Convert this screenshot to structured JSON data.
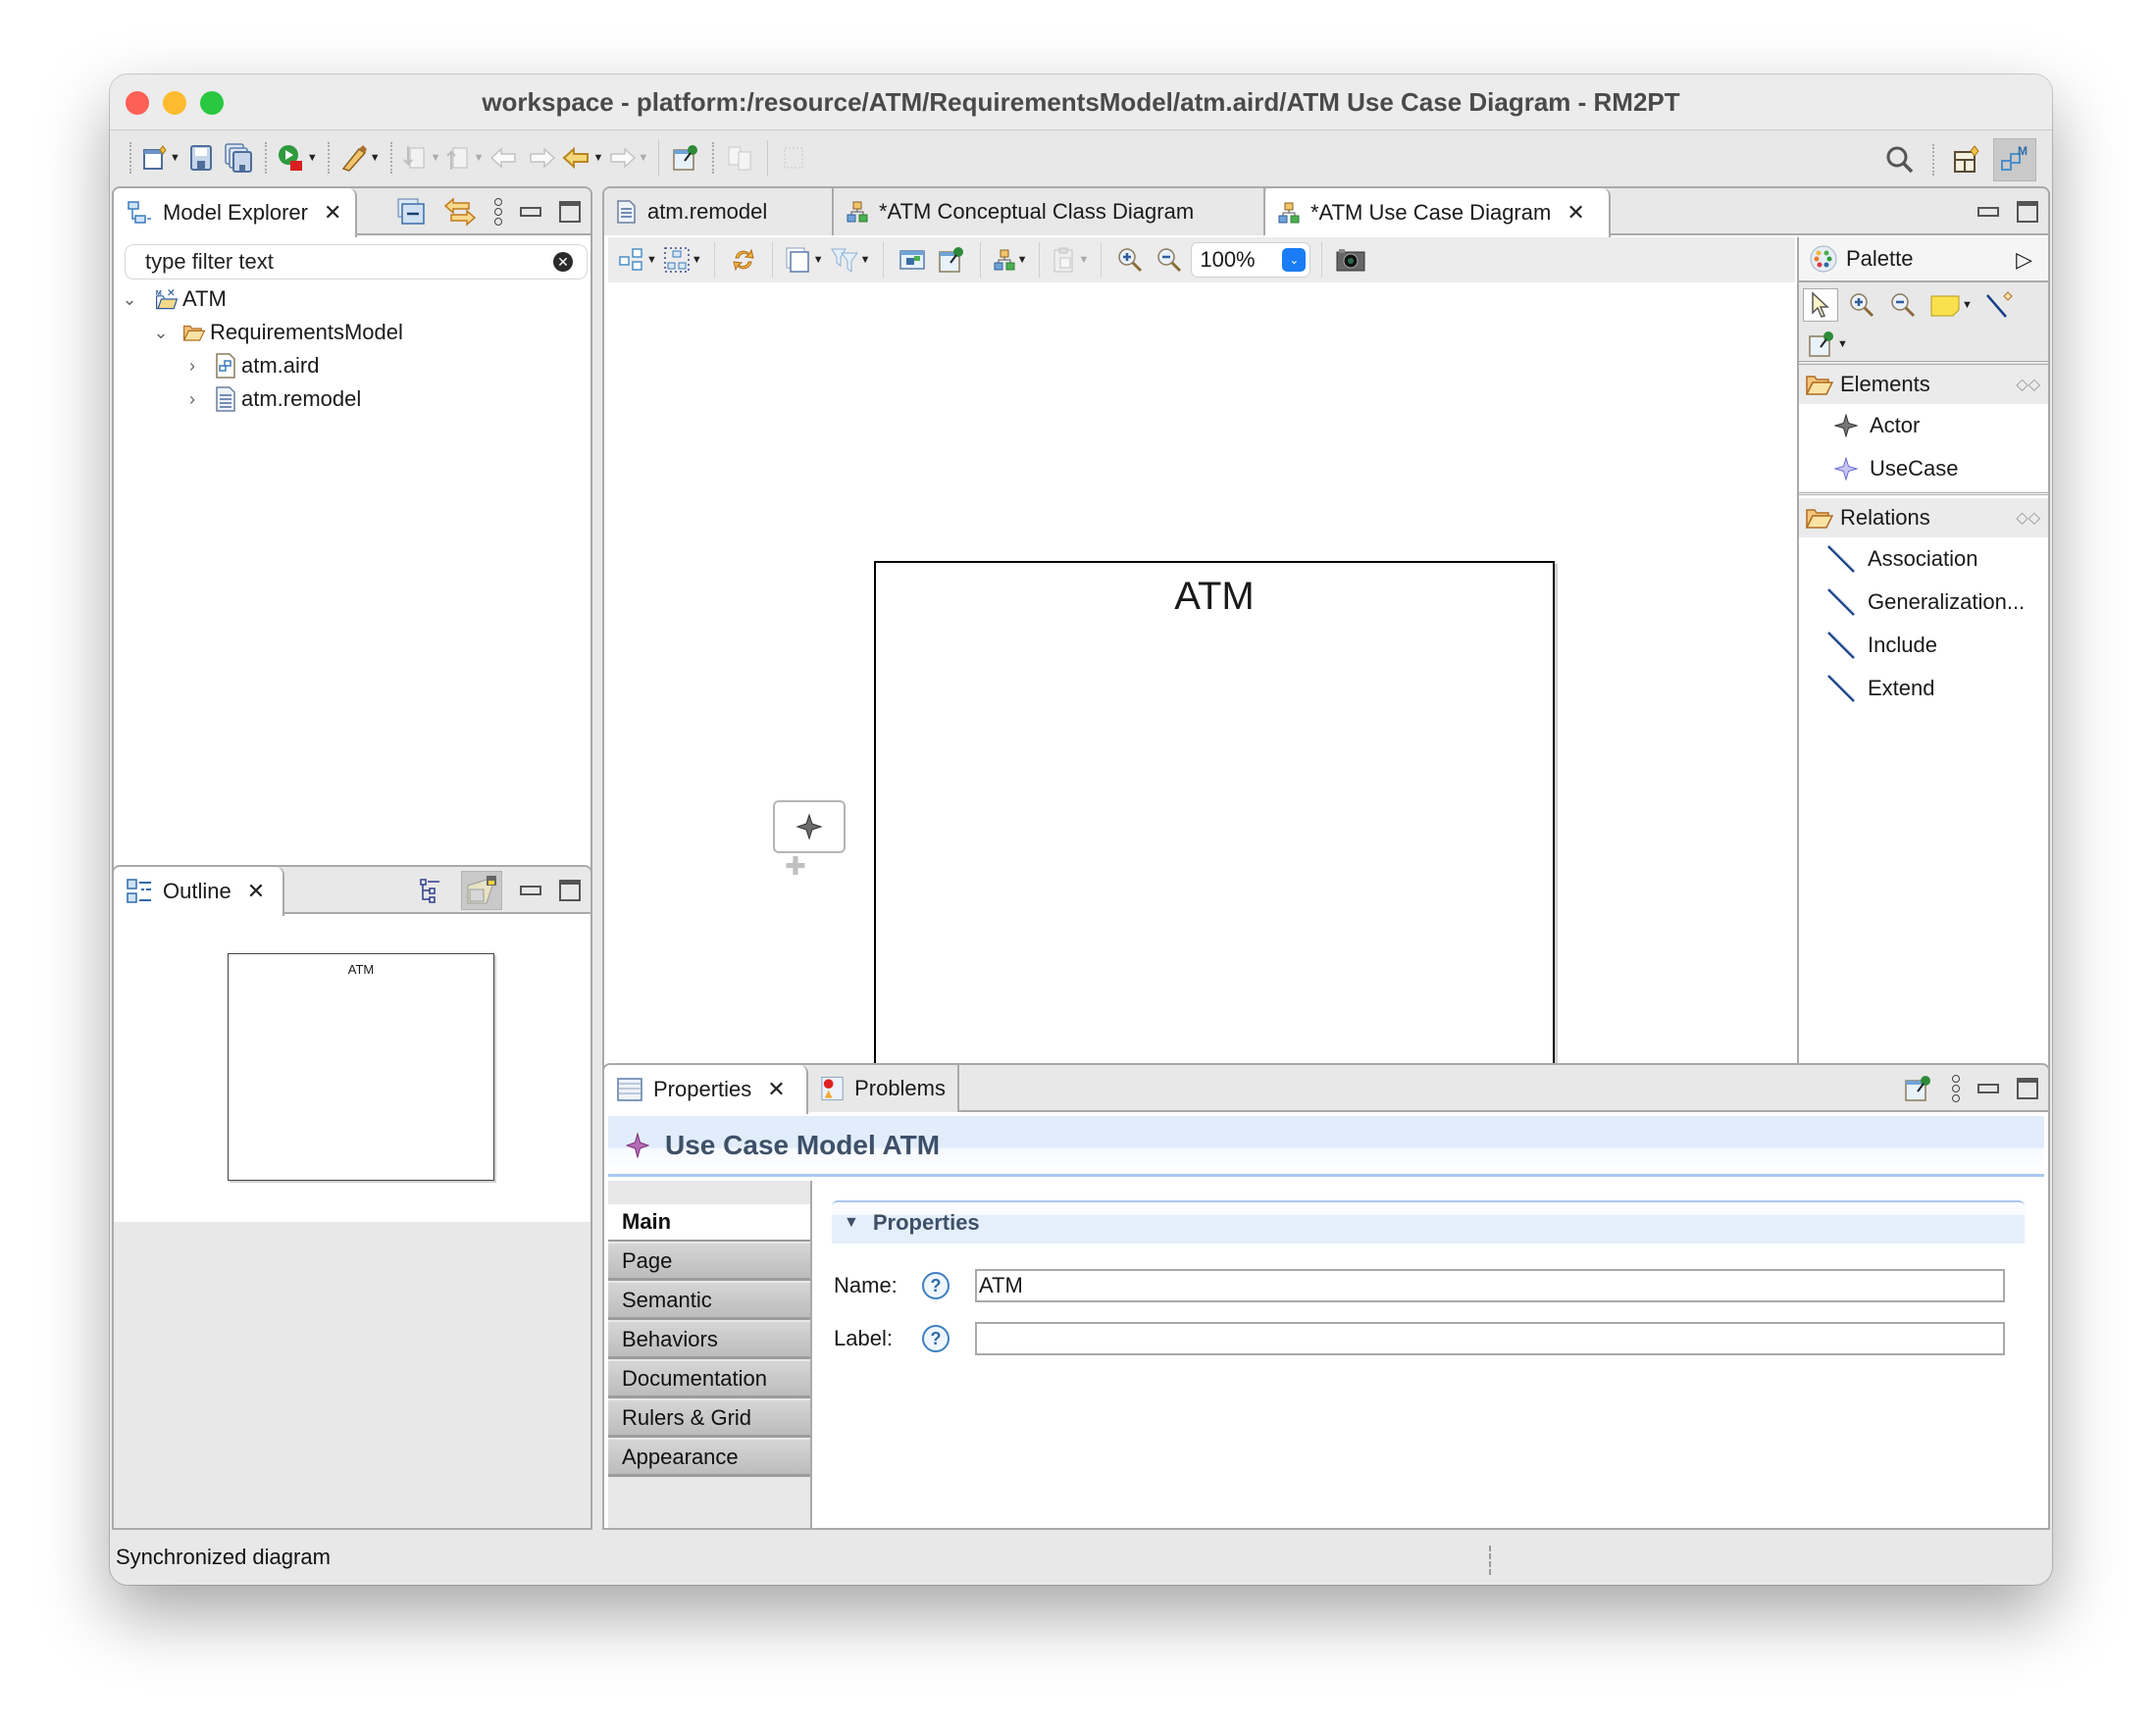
{
  "window": {
    "title": "workspace - platform:/resource/ATM/RequirementsModel/atm.aird/ATM Use Case Diagram - RM2PT"
  },
  "main_toolbar": {
    "buttons": [
      "new-wizard",
      "save",
      "save-all",
      "run",
      "external-tools",
      "next-annotation",
      "previous-annotation",
      "last-edit-location-back",
      "last-edit-location-forward",
      "back",
      "forward",
      "pin-editor",
      "toggle-split-editor",
      "toggle-block-selection"
    ],
    "right_buttons": [
      "search",
      "open-perspective",
      "modeling-perspective"
    ]
  },
  "model_explorer": {
    "tab_label": "Model Explorer",
    "filter_placeholder": "type filter text",
    "tree": [
      {
        "label": "ATM",
        "level": 0,
        "expanded": true,
        "icon": "modeling-project-icon"
      },
      {
        "label": "RequirementsModel",
        "level": 1,
        "expanded": true,
        "icon": "folder-icon"
      },
      {
        "label": "atm.aird",
        "level": 2,
        "expanded": false,
        "icon": "aird-file-icon"
      },
      {
        "label": "atm.remodel",
        "level": 2,
        "expanded": false,
        "icon": "text-file-icon"
      }
    ]
  },
  "outline": {
    "tab_label": "Outline",
    "thumbnail_label": "ATM"
  },
  "editor": {
    "tabs": [
      {
        "label": "atm.remodel",
        "active": false,
        "dirty": false
      },
      {
        "label": "*ATM Conceptual Class Diagram",
        "active": false,
        "dirty": true
      },
      {
        "label": "*ATM Use Case Diagram",
        "active": true,
        "dirty": true
      }
    ],
    "zoom_level": "100%",
    "diagram": {
      "container_label": "ATM"
    }
  },
  "palette": {
    "title": "Palette",
    "drawers": [
      {
        "label": "Elements",
        "items": [
          "Actor",
          "UseCase"
        ]
      },
      {
        "label": "Relations",
        "items": [
          "Association",
          "Generalization...",
          "Include",
          "Extend"
        ]
      }
    ]
  },
  "properties": {
    "tabs": [
      {
        "label": "Properties",
        "active": true
      },
      {
        "label": "Problems",
        "active": false
      }
    ],
    "title": "Use Case Model ATM",
    "side_tabs": [
      "Main",
      "Page",
      "Semantic",
      "Behaviors",
      "Documentation",
      "Rulers & Grid",
      "Appearance"
    ],
    "active_side_tab": "Main",
    "section_title": "Properties",
    "fields": [
      {
        "label": "Name:",
        "value": "ATM"
      },
      {
        "label": "Label:",
        "value": ""
      }
    ]
  },
  "status_bar": {
    "message": "Synchronized diagram"
  }
}
